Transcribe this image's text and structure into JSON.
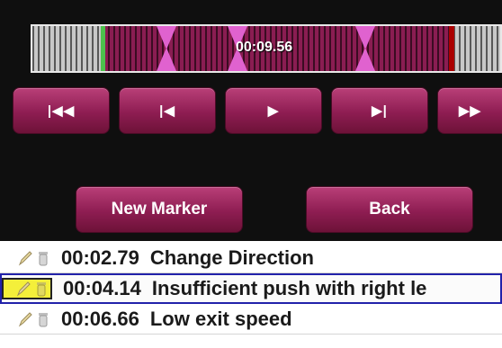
{
  "timeline": {
    "current_time": "00:09.56",
    "marker_positions": [
      0.29,
      0.46,
      0.72
    ]
  },
  "transport": {
    "first_label": "|◀◀",
    "prev_label": "|◀",
    "play_label": "▶",
    "next_label": "▶|",
    "forward_label": "▶▶"
  },
  "actions": {
    "new_marker_label": "New Marker",
    "back_label": "Back"
  },
  "markers": [
    {
      "time": "00:02.79",
      "label": "Change Direction",
      "selected": false
    },
    {
      "time": "00:04.14",
      "label": "Insufficient push with right le",
      "selected": true
    },
    {
      "time": "00:06.66",
      "label": "Low exit speed",
      "selected": false
    }
  ],
  "colors": {
    "accent": "#8e1d52",
    "marker": "#e062cf",
    "start": "#4cc24c",
    "end": "#aa0000",
    "highlight": "#f4ef3a"
  }
}
